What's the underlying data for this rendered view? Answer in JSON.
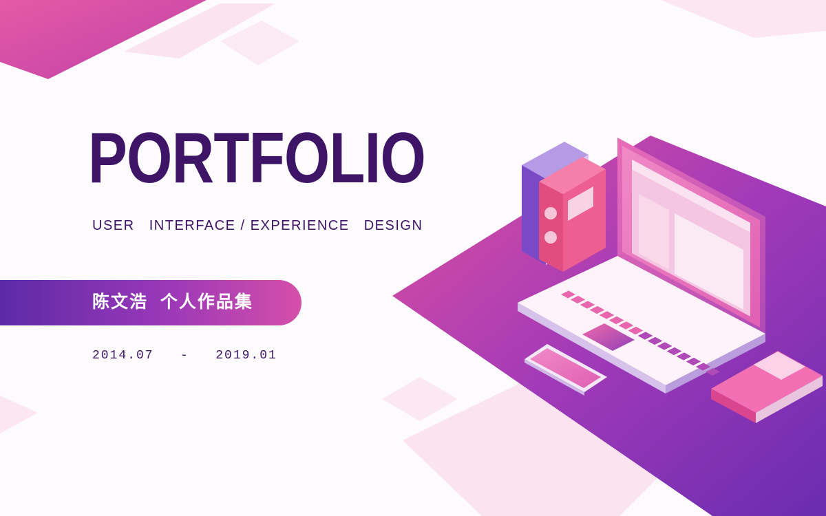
{
  "cover": {
    "title": "PORTFOLIO",
    "subtitle": "USER   INTERFACE / EXPERIENCE   DESIGN",
    "name_label": "陈文浩  个人作品集",
    "date_range": "2014.07   -   2019.01"
  },
  "colors": {
    "title": "#3d1466",
    "accent_purple": "#6a2fb0",
    "accent_pink": "#e2509c",
    "background": "#fdfbfd"
  },
  "illustration": {
    "icons": [
      "laptop-icon",
      "binder-icon",
      "phone-icon",
      "notebook-icon"
    ]
  }
}
